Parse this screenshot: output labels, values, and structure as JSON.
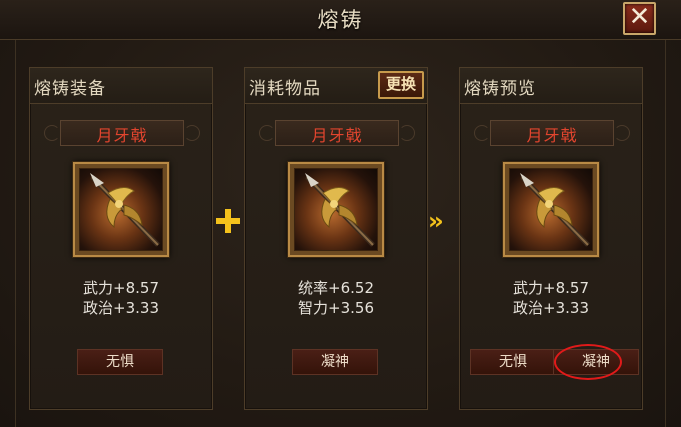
{
  "window": {
    "title": "熔铸"
  },
  "panels": [
    {
      "header": "熔铸装备",
      "item_name": "月牙戟",
      "stats": [
        "武力+8.57",
        "政治+3.33"
      ],
      "traits": [
        "无惧"
      ]
    },
    {
      "header": "消耗物品",
      "swap_label": "更换",
      "item_name": "月牙戟",
      "stats": [
        "统率+6.52",
        "智力+3.56"
      ],
      "traits": [
        "凝神"
      ]
    },
    {
      "header": "熔铸预览",
      "item_name": "月牙戟",
      "stats": [
        "武力+8.57",
        "政治+3.33"
      ],
      "traits": [
        "无惧",
        "凝神"
      ]
    }
  ],
  "icons": {
    "close": "close-icon",
    "plus": "plus-icon",
    "arrow": "double-chevron-right-icon",
    "weapon": "crescent-halberd-icon"
  },
  "colors": {
    "item_name": "#e2452e",
    "operator": "#f4c21c",
    "highlight": "#e11a1a"
  }
}
